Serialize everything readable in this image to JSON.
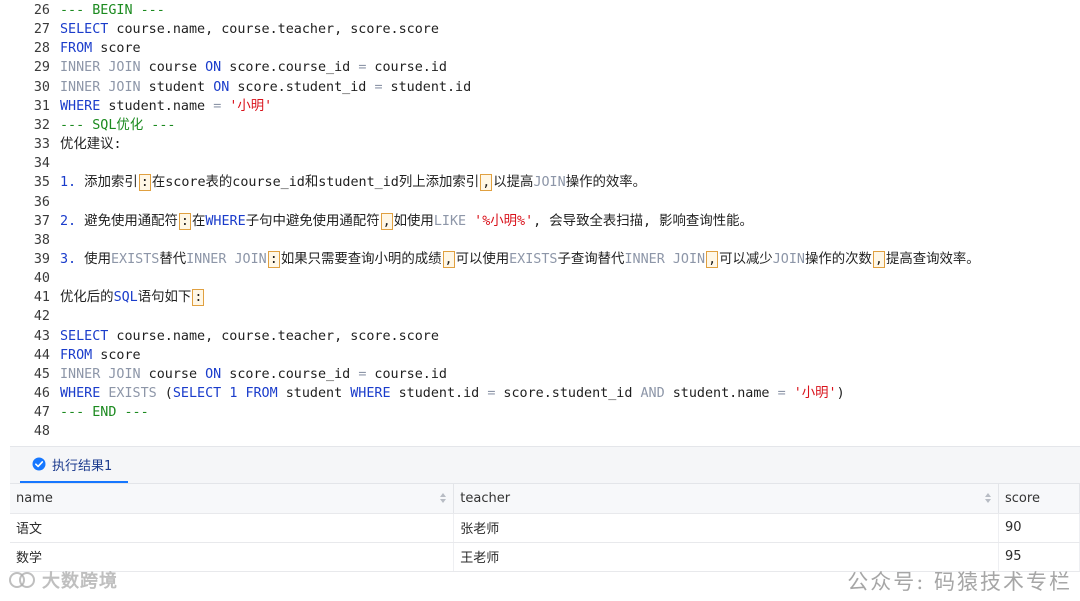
{
  "editor": {
    "lines": [
      {
        "num": "26",
        "tokens": [
          {
            "t": "--- BEGIN ---",
            "c": "cmt"
          }
        ]
      },
      {
        "num": "27",
        "tokens": [
          {
            "t": "SELECT",
            "c": "kw"
          },
          {
            "t": " course.name, course.teacher, score.score",
            "c": "txt"
          }
        ]
      },
      {
        "num": "28",
        "tokens": [
          {
            "t": "FROM",
            "c": "kw"
          },
          {
            "t": " score",
            "c": "txt"
          }
        ]
      },
      {
        "num": "29",
        "tokens": [
          {
            "t": "INNER JOIN",
            "c": "kw2"
          },
          {
            "t": " course ",
            "c": "txt"
          },
          {
            "t": "ON",
            "c": "kw"
          },
          {
            "t": " score.course_id ",
            "c": "txt"
          },
          {
            "t": "=",
            "c": "kw2"
          },
          {
            "t": " course.id",
            "c": "txt"
          }
        ]
      },
      {
        "num": "30",
        "tokens": [
          {
            "t": "INNER JOIN",
            "c": "kw2"
          },
          {
            "t": " student ",
            "c": "txt"
          },
          {
            "t": "ON",
            "c": "kw"
          },
          {
            "t": " score.student_id ",
            "c": "txt"
          },
          {
            "t": "=",
            "c": "kw2"
          },
          {
            "t": " student.id",
            "c": "txt"
          }
        ]
      },
      {
        "num": "31",
        "tokens": [
          {
            "t": "WHERE",
            "c": "kw"
          },
          {
            "t": " student.name ",
            "c": "txt"
          },
          {
            "t": "=",
            "c": "kw2"
          },
          {
            "t": " ",
            "c": "txt"
          },
          {
            "t": "'小明'",
            "c": "str"
          }
        ]
      },
      {
        "num": "32",
        "tokens": [
          {
            "t": "--- SQL优化 ---",
            "c": "cmt"
          }
        ]
      },
      {
        "num": "33",
        "tokens": [
          {
            "t": "优化建议:",
            "c": "txt"
          }
        ]
      },
      {
        "num": "34",
        "tokens": []
      },
      {
        "num": "35",
        "tokens": [
          {
            "t": "1.",
            "c": "num"
          },
          {
            "t": " 添加索引",
            "c": "txt"
          },
          {
            "t": ":",
            "c": "mark"
          },
          {
            "t": "在score表的course_id和student_id列上添加索引",
            "c": "txt"
          },
          {
            "t": ",",
            "c": "mark"
          },
          {
            "t": "以提高",
            "c": "txt"
          },
          {
            "t": "JOIN",
            "c": "kw2"
          },
          {
            "t": "操作的效率。",
            "c": "txt"
          }
        ]
      },
      {
        "num": "36",
        "tokens": []
      },
      {
        "num": "37",
        "tokens": [
          {
            "t": "2.",
            "c": "num"
          },
          {
            "t": " 避免使用通配符",
            "c": "txt"
          },
          {
            "t": ":",
            "c": "mark"
          },
          {
            "t": "在",
            "c": "txt"
          },
          {
            "t": "WHERE",
            "c": "kw"
          },
          {
            "t": "子句中避免使用通配符",
            "c": "txt"
          },
          {
            "t": ",",
            "c": "mark"
          },
          {
            "t": "如使用",
            "c": "txt"
          },
          {
            "t": "LIKE",
            "c": "kw2"
          },
          {
            "t": " ",
            "c": "txt"
          },
          {
            "t": "'%小明%'",
            "c": "str"
          },
          {
            "t": ", 会导致全表扫描, 影响查询性能。",
            "c": "txt"
          }
        ]
      },
      {
        "num": "38",
        "tokens": []
      },
      {
        "num": "39",
        "tokens": [
          {
            "t": "3.",
            "c": "num"
          },
          {
            "t": " 使用",
            "c": "txt"
          },
          {
            "t": "EXISTS",
            "c": "kw2"
          },
          {
            "t": "替代",
            "c": "txt"
          },
          {
            "t": "INNER JOIN",
            "c": "kw2"
          },
          {
            "t": ":",
            "c": "mark"
          },
          {
            "t": "如果只需要查询小明的成绩",
            "c": "txt"
          },
          {
            "t": ",",
            "c": "mark"
          },
          {
            "t": "可以使用",
            "c": "txt"
          },
          {
            "t": "EXISTS",
            "c": "kw2"
          },
          {
            "t": "子查询替代",
            "c": "txt"
          },
          {
            "t": "INNER JOIN",
            "c": "kw2"
          },
          {
            "t": ",",
            "c": "mark"
          },
          {
            "t": "可以减少",
            "c": "txt"
          },
          {
            "t": "JOIN",
            "c": "kw2"
          },
          {
            "t": "操作的次数",
            "c": "txt"
          },
          {
            "t": ",",
            "c": "mark"
          },
          {
            "t": "提高查询效率。",
            "c": "txt"
          }
        ]
      },
      {
        "num": "40",
        "tokens": []
      },
      {
        "num": "41",
        "tokens": [
          {
            "t": "优化后的",
            "c": "txt"
          },
          {
            "t": "SQL",
            "c": "kw"
          },
          {
            "t": "语句如下",
            "c": "txt"
          },
          {
            "t": ":",
            "c": "mark"
          }
        ]
      },
      {
        "num": "42",
        "tokens": []
      },
      {
        "num": "43",
        "tokens": [
          {
            "t": "SELECT",
            "c": "kw"
          },
          {
            "t": " course.name, course.teacher, score.score",
            "c": "txt"
          }
        ]
      },
      {
        "num": "44",
        "tokens": [
          {
            "t": "FROM",
            "c": "kw"
          },
          {
            "t": " score",
            "c": "txt"
          }
        ]
      },
      {
        "num": "45",
        "tokens": [
          {
            "t": "INNER JOIN",
            "c": "kw2"
          },
          {
            "t": " course ",
            "c": "txt"
          },
          {
            "t": "ON",
            "c": "kw"
          },
          {
            "t": " score.course_id ",
            "c": "txt"
          },
          {
            "t": "=",
            "c": "kw2"
          },
          {
            "t": " course.id",
            "c": "txt"
          }
        ]
      },
      {
        "num": "46",
        "tokens": [
          {
            "t": "WHERE",
            "c": "kw"
          },
          {
            "t": " ",
            "c": "txt"
          },
          {
            "t": "EXISTS",
            "c": "kw2"
          },
          {
            "t": " (",
            "c": "txt"
          },
          {
            "t": "SELECT",
            "c": "kw"
          },
          {
            "t": " ",
            "c": "txt"
          },
          {
            "t": "1",
            "c": "num"
          },
          {
            "t": " ",
            "c": "txt"
          },
          {
            "t": "FROM",
            "c": "kw"
          },
          {
            "t": " student ",
            "c": "txt"
          },
          {
            "t": "WHERE",
            "c": "kw"
          },
          {
            "t": " student.id ",
            "c": "txt"
          },
          {
            "t": "=",
            "c": "kw2"
          },
          {
            "t": " score.student_id ",
            "c": "txt"
          },
          {
            "t": "AND",
            "c": "kw2"
          },
          {
            "t": " student.name ",
            "c": "txt"
          },
          {
            "t": "=",
            "c": "kw2"
          },
          {
            "t": " ",
            "c": "txt"
          },
          {
            "t": "'小明'",
            "c": "str"
          },
          {
            "t": ")",
            "c": "txt"
          }
        ]
      },
      {
        "num": "47",
        "tokens": [
          {
            "t": "--- END ---",
            "c": "cmt"
          }
        ]
      },
      {
        "num": "48",
        "tokens": []
      }
    ]
  },
  "results": {
    "tab_label": "执行结果1",
    "columns": [
      "name",
      "teacher",
      "score"
    ],
    "rows": [
      [
        "语文",
        "张老师",
        "90"
      ],
      [
        "数学",
        "王老师",
        "95"
      ]
    ]
  },
  "watermark": {
    "left_text": "大数跨境",
    "right_text": "公众号: 码猿技术专栏"
  },
  "colors": {
    "keyword": "#1a3ccb",
    "keyword_secondary": "#8d96a8",
    "string": "#d9121b",
    "comment": "#1b8a1f",
    "tab_accent": "#1677ff"
  }
}
